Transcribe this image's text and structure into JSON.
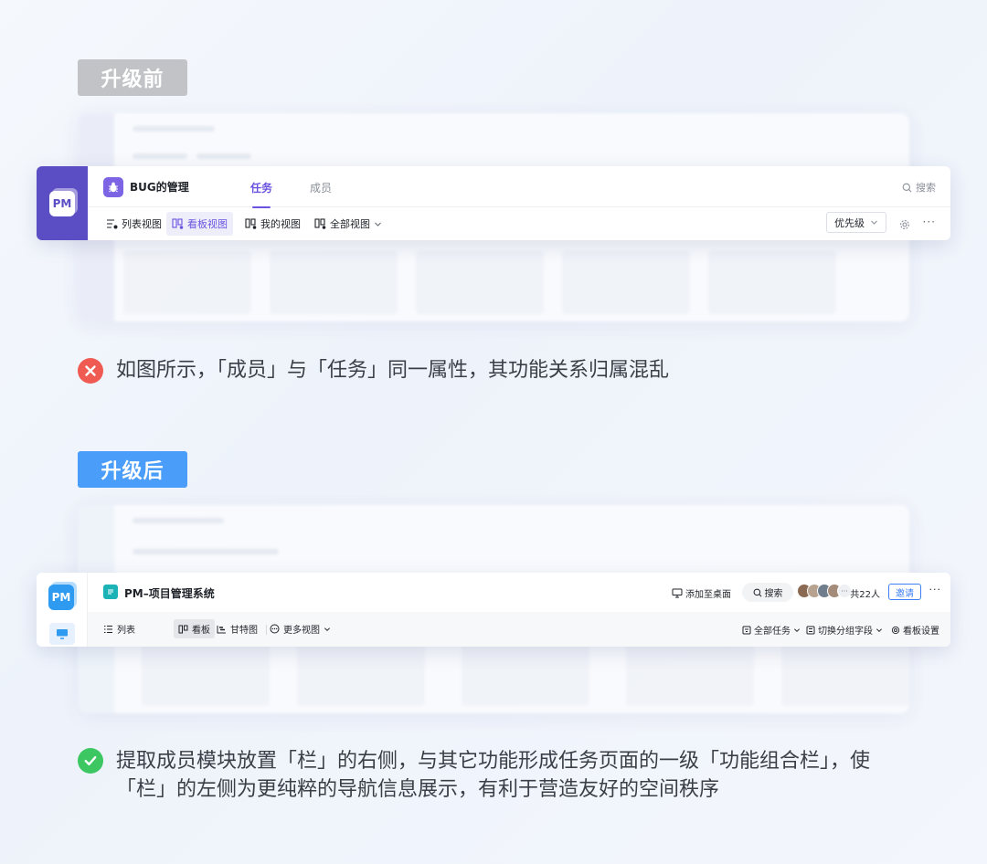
{
  "sections": {
    "before": {
      "tag": "升级前",
      "sidebar_logo": "PM",
      "project_name": "BUG的管理",
      "tabs": [
        {
          "label": "任务",
          "active": true
        },
        {
          "label": "成员",
          "active": false
        }
      ],
      "search_label": "搜索",
      "views": [
        {
          "label": "列表视图",
          "icon": "list-view-icon",
          "active": false
        },
        {
          "label": "看板视图",
          "icon": "kanban-icon",
          "active": true
        },
        {
          "label": "我的视图",
          "icon": "my-view-icon",
          "active": false
        },
        {
          "label": "全部视图",
          "icon": "all-views-icon",
          "active": false
        }
      ],
      "priority_select": "优先级",
      "note": "如图所示，「成员」与「任务」同一属性，其功能关系归属混乱"
    },
    "after": {
      "tag": "升级后",
      "sidebar_logo": "PM",
      "project_name": "PM–项目管理系统",
      "add_to_desktop": "添加至桌面",
      "search_label": "搜索",
      "member_count": "共22人",
      "invite_button": "邀请",
      "views": [
        {
          "label": "列表",
          "icon": "list-icon",
          "active": false
        },
        {
          "label": "看板",
          "icon": "kanban-icon",
          "active": true
        },
        {
          "label": "甘特图",
          "icon": "gantt-icon",
          "active": false
        },
        {
          "label": "更多视图",
          "icon": "more-views-icon",
          "active": false
        }
      ],
      "right_tools": [
        {
          "label": "全部任务",
          "icon": "filter-icon"
        },
        {
          "label": "切换分组字段",
          "icon": "group-icon"
        },
        {
          "label": "看板设置",
          "icon": "settings-icon"
        }
      ],
      "note": "提取成员模块放置「栏」的右侧，与其它功能形成任务页面的一级「功能组合栏」，使「栏」的左侧为更纯粹的导航信息展示，有利于营造友好的空间秩序"
    }
  },
  "colors": {
    "before_accent": "#6a52e0",
    "before_sidebar": "#5b4ec4",
    "after_accent": "#2f9bf0",
    "invite": "#3d7ff6",
    "bad": "#ef5b52",
    "good": "#3cc763",
    "tag_before": "#c1c3c7",
    "tag_after": "#4a9df8"
  }
}
